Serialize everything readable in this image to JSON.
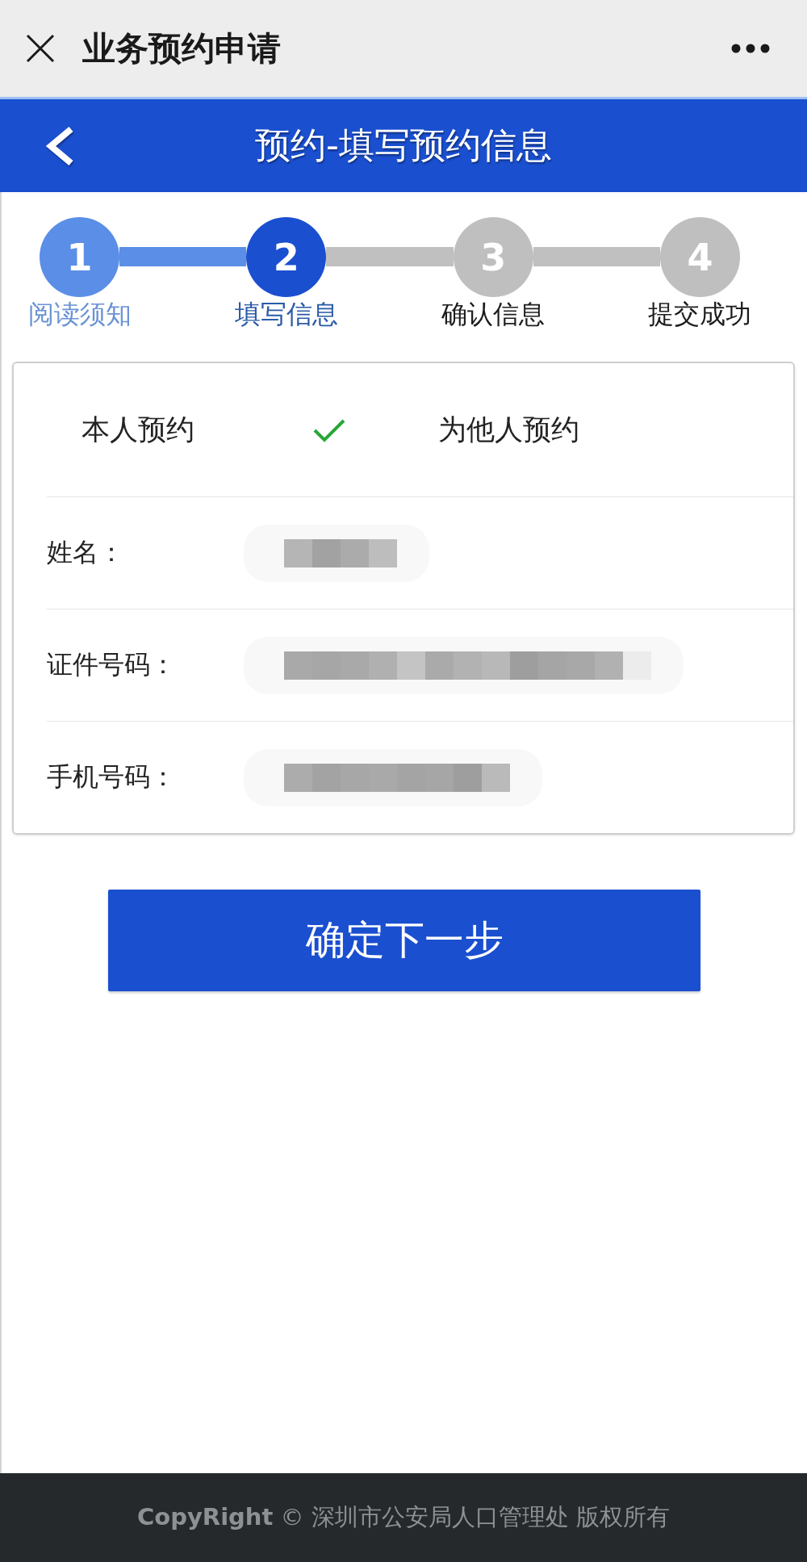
{
  "top_bar": {
    "title": "业务预约申请"
  },
  "header": {
    "title": "预约-填写预约信息"
  },
  "steps": [
    {
      "number": "1",
      "label": "阅读须知",
      "completed": true,
      "current": false
    },
    {
      "number": "2",
      "label": "填写信息",
      "completed": false,
      "current": true
    },
    {
      "number": "3",
      "label": "确认信息",
      "completed": false,
      "current": false
    },
    {
      "number": "4",
      "label": "提交成功",
      "completed": false,
      "current": false
    }
  ],
  "form": {
    "options": [
      {
        "label": "本人预约",
        "selected": true
      },
      {
        "label": "为他人预约",
        "selected": false
      }
    ],
    "fields": [
      {
        "label": "姓名：",
        "redacted": true
      },
      {
        "label": "证件号码：",
        "redacted": true
      },
      {
        "label": "手机号码：",
        "redacted": true
      }
    ]
  },
  "submit_button": {
    "label": "确定下一步"
  },
  "footer": {
    "text": "**CopyRight** © 深圳市公安局人口管理处 版权所有"
  }
}
